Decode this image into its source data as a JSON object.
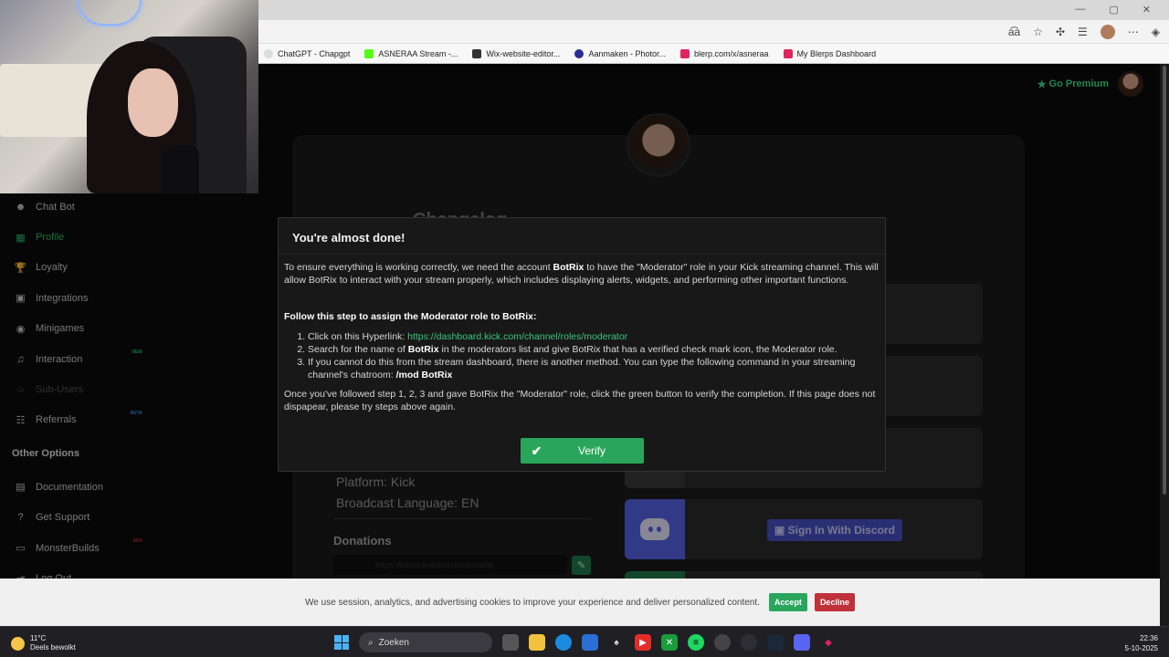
{
  "browser": {
    "bookmarks": [
      {
        "label": "ChatGPT - Chapgpt",
        "color": "#dddddd"
      },
      {
        "label": "ASNERAA Stream -...",
        "color": "#53fc18"
      },
      {
        "label": "Wix-website-editor...",
        "color": "#333333"
      },
      {
        "label": "Aanmaken - Photor...",
        "color": "#2b2d8f"
      },
      {
        "label": "blerp.com/x/asneraa",
        "color": "#e0245e"
      },
      {
        "label": "My Blerps Dashboard",
        "color": "#e0245e"
      }
    ]
  },
  "topbar": {
    "premium_label": "Go Premium",
    "star_icon": "★"
  },
  "sidebar": {
    "items": [
      {
        "label": "Chat Bot",
        "icon": "☻",
        "state": "normal"
      },
      {
        "label": "Profile",
        "icon": "▦",
        "state": "active"
      },
      {
        "label": "Loyalty",
        "icon": "🏆",
        "state": "normal"
      },
      {
        "label": "Integrations",
        "icon": "▣",
        "state": "normal"
      },
      {
        "label": "Minigames",
        "icon": "◉",
        "state": "normal"
      },
      {
        "label": "Interaction",
        "icon": "♫",
        "state": "normal",
        "badge": "NEW"
      },
      {
        "label": "Sub-Users",
        "icon": "☺",
        "state": "dim"
      },
      {
        "label": "Referrals",
        "icon": "☷",
        "state": "normal",
        "badge": "BETA"
      }
    ],
    "other_heading": "Other Options",
    "other_items": [
      {
        "label": "Documentation",
        "icon": "▤"
      },
      {
        "label": "Get Support",
        "icon": "?"
      },
      {
        "label": "MonsterBuilds",
        "icon": "▭",
        "badge": "ADV"
      },
      {
        "label": "Log Out",
        "icon": "⇥"
      }
    ]
  },
  "main": {
    "changelog_title": "Changelog",
    "platform": "Platform: Kick",
    "language": "Broadcast Language: EN",
    "donations_label": "Donations",
    "donations_url": "https://botrix.live/kick/asneraa/tip",
    "discord_button": "Sign In With Discord"
  },
  "modal": {
    "title": "You're almost done!",
    "intro_1": "To ensure everything is working correctly, we need the account ",
    "intro_bold": "BotRix",
    "intro_2": " to have the \"Moderator\" role in your Kick streaming channel. This will allow BotRix to interact with your stream properly, which includes displaying alerts, widgets, and performing other important functions.",
    "steps_heading": "Follow this step to assign the Moderator role to BotRix:",
    "step1_prefix": "Click on this Hyperlink: ",
    "step1_link": "https://dashboard.kick.com/channel/roles/moderator",
    "step2_prefix": "Search for the name of ",
    "step2_bold": "BotRix",
    "step2_suffix": " in the moderators list and give BotRix that has a verified check mark icon, the Moderator role.",
    "step3_prefix": "If you cannot do this from the stream dashboard, there is another method. You can type the following command in your streaming channel's chatroom: ",
    "step3_bold": "/mod BotRix",
    "outro": "Once you've followed step 1, 2, 3 and gave BotRix the \"Moderator\" role, click the green button to verify the completion. If this page does not dispapear, please try steps above again.",
    "verify_label": "Verify"
  },
  "cookie": {
    "text": "We use session, analytics, and advertising cookies to improve your experience and deliver personalized content.",
    "accept": "Accept",
    "decline": "Decline"
  },
  "taskbar": {
    "temp": "11°C",
    "weather": "Deels bewolkt",
    "search": "Zoeken",
    "time": "22:36",
    "date": "5-10-2025"
  },
  "colors": {
    "accent": "#2aa65c",
    "decline": "#c0313a",
    "discord": "#5662e8"
  }
}
